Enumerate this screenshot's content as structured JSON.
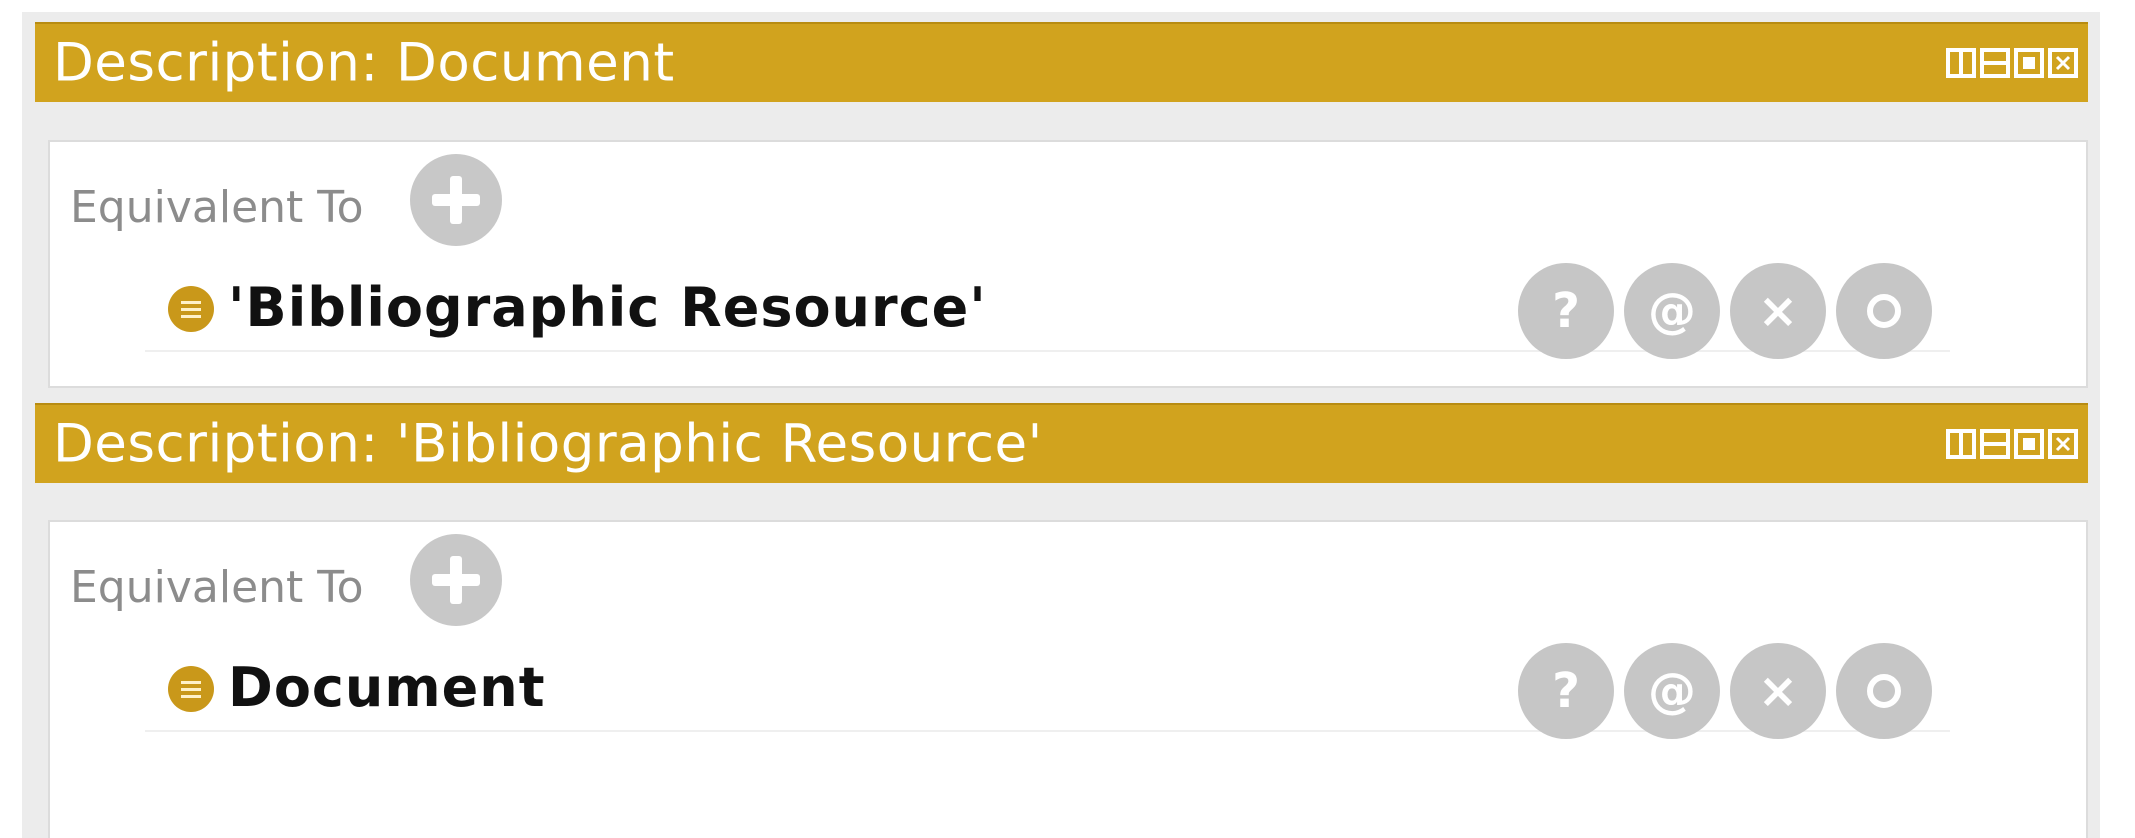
{
  "panels": [
    {
      "title": "Description: Document",
      "section_label": "Equivalent To",
      "entry": "'Bibliographic Resource'",
      "actions": [
        "?",
        "@",
        "×",
        ""
      ]
    },
    {
      "title": "Description: 'Bibliographic Resource'",
      "section_label": "Equivalent To",
      "entry": "Document",
      "actions": [
        "?",
        "@",
        "×",
        ""
      ]
    }
  ],
  "colors": {
    "header": "#d1a31e",
    "class_icon": "#c9981a",
    "action_button": "#c6c6c6"
  },
  "icons": {
    "window_controls": [
      "split-vertical-icon",
      "split-horizontal-icon",
      "float-icon",
      "close-icon"
    ],
    "add": "add-icon",
    "class": "class-icon",
    "actions": [
      "explain-icon",
      "annotate-icon",
      "delete-icon",
      "edit-icon"
    ]
  }
}
